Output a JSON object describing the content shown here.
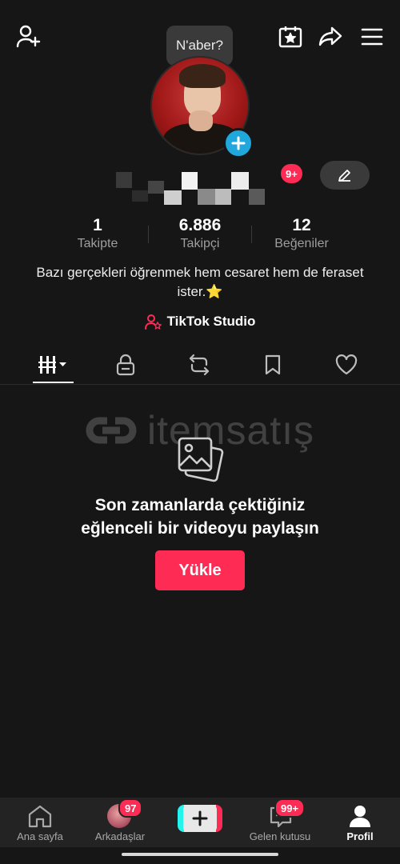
{
  "bubble": {
    "text": "N'aber?"
  },
  "profile": {
    "notif_badge": "9+"
  },
  "stats": [
    {
      "num": "1",
      "label": "Takipte"
    },
    {
      "num": "6.886",
      "label": "Takipçi"
    },
    {
      "num": "12",
      "label": "Beğeniler"
    }
  ],
  "bio": "Bazı gerçekleri öğrenmek hem cesaret hem de feraset ister.⭐",
  "studio": {
    "label": "TikTok Studio"
  },
  "watermark": {
    "text": "itemsatış"
  },
  "empty": {
    "title_line1": "Son zamanlarda çektiğiniz",
    "title_line2": "eğlenceli bir videoyu paylaşın",
    "upload_label": "Yükle"
  },
  "nav": {
    "home": "Ana sayfa",
    "friends": "Arkadaşlar",
    "friends_badge": "97",
    "inbox": "Gelen kutusu",
    "inbox_badge": "99+",
    "profile": "Profil"
  },
  "colors": {
    "accent": "#fe2c55",
    "blue": "#20a7dc",
    "bg": "#161616"
  }
}
